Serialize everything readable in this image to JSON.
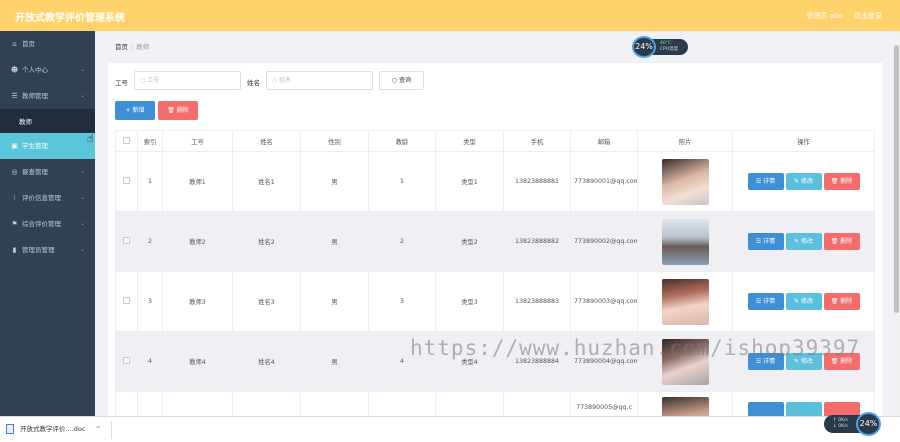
{
  "header": {
    "title": "开放式教学评价管理系统",
    "user": "管理员 abo",
    "logout": "退出登录"
  },
  "sidebar": {
    "items": [
      {
        "icon": "home-icon",
        "glyph": "⌂",
        "label": "首页",
        "chevron": ""
      },
      {
        "icon": "user-icon",
        "glyph": "☻",
        "label": "个人中心",
        "chevron": "⌄"
      },
      {
        "icon": "teacher-icon",
        "glyph": "☰",
        "label": "教师管理",
        "chevron": "⌄"
      },
      {
        "icon": "student-icon",
        "glyph": "▣",
        "label": "学生管理",
        "chevron": "⌄"
      },
      {
        "icon": "evaluator-icon",
        "glyph": "◎",
        "label": "督查管理",
        "chevron": "⌄"
      },
      {
        "icon": "evaluation-icon",
        "glyph": "⁝",
        "label": "评价信息管理",
        "chevron": "⌄"
      },
      {
        "icon": "flag-icon",
        "glyph": "⚑",
        "label": "综合评价管理",
        "chevron": "⌄"
      },
      {
        "icon": "chart-icon",
        "glyph": "▮",
        "label": "管理员管理",
        "chevron": "⌄"
      }
    ],
    "subitem": "教师"
  },
  "breadcrumb": {
    "home": "首页",
    "current": "教师"
  },
  "search": {
    "id_label": "工号",
    "id_placeholder": "工号",
    "name_label": "姓名",
    "name_placeholder": "姓名",
    "button": "查询"
  },
  "toolbar": {
    "add": "+ 新增",
    "delete": "删除"
  },
  "table": {
    "headers": [
      "",
      "索引",
      "工号",
      "姓名",
      "性别",
      "教龄",
      "类型",
      "手机",
      "邮箱",
      "照片",
      "操作"
    ],
    "rows": [
      {
        "index": "1",
        "id": "教师1",
        "name": "姓名1",
        "gender": "男",
        "years": "1",
        "type": "类型1",
        "phone": "13823888881",
        "email": "773890001@qq.com"
      },
      {
        "index": "2",
        "id": "教师2",
        "name": "姓名2",
        "gender": "男",
        "years": "2",
        "type": "类型2",
        "phone": "13823888882",
        "email": "773890002@qq.com"
      },
      {
        "index": "3",
        "id": "教师3",
        "name": "姓名3",
        "gender": "男",
        "years": "3",
        "type": "类型3",
        "phone": "13823888883",
        "email": "773890003@qq.com"
      },
      {
        "index": "4",
        "id": "教师4",
        "name": "姓名4",
        "gender": "男",
        "years": "4",
        "type": "类型4",
        "phone": "13823888884",
        "email": "773890004@qq.com"
      },
      {
        "index": "",
        "id": "",
        "name": "",
        "gender": "",
        "years": "",
        "type": "",
        "phone": "",
        "email": "773890005@qq.c"
      }
    ],
    "actions": {
      "view": "详情",
      "edit": "修改",
      "remove": "删除"
    }
  },
  "cpu_top": {
    "percent": "24%",
    "temp": "40°C",
    "label": "CPU温度"
  },
  "cpu_bottom": {
    "percent": "24%",
    "line1": "0K/s",
    "line2": "0K/s"
  },
  "downloads": {
    "file": "开放式教学评价....doc"
  },
  "watermark": "https://www.huzhan.com/ishop39397",
  "colors": {
    "header": "#ffd26b",
    "sidebar": "#304156",
    "active": "#5bc6d9",
    "primary": "#3f8fd6",
    "danger": "#f56c6c",
    "info": "#5bc0de"
  }
}
